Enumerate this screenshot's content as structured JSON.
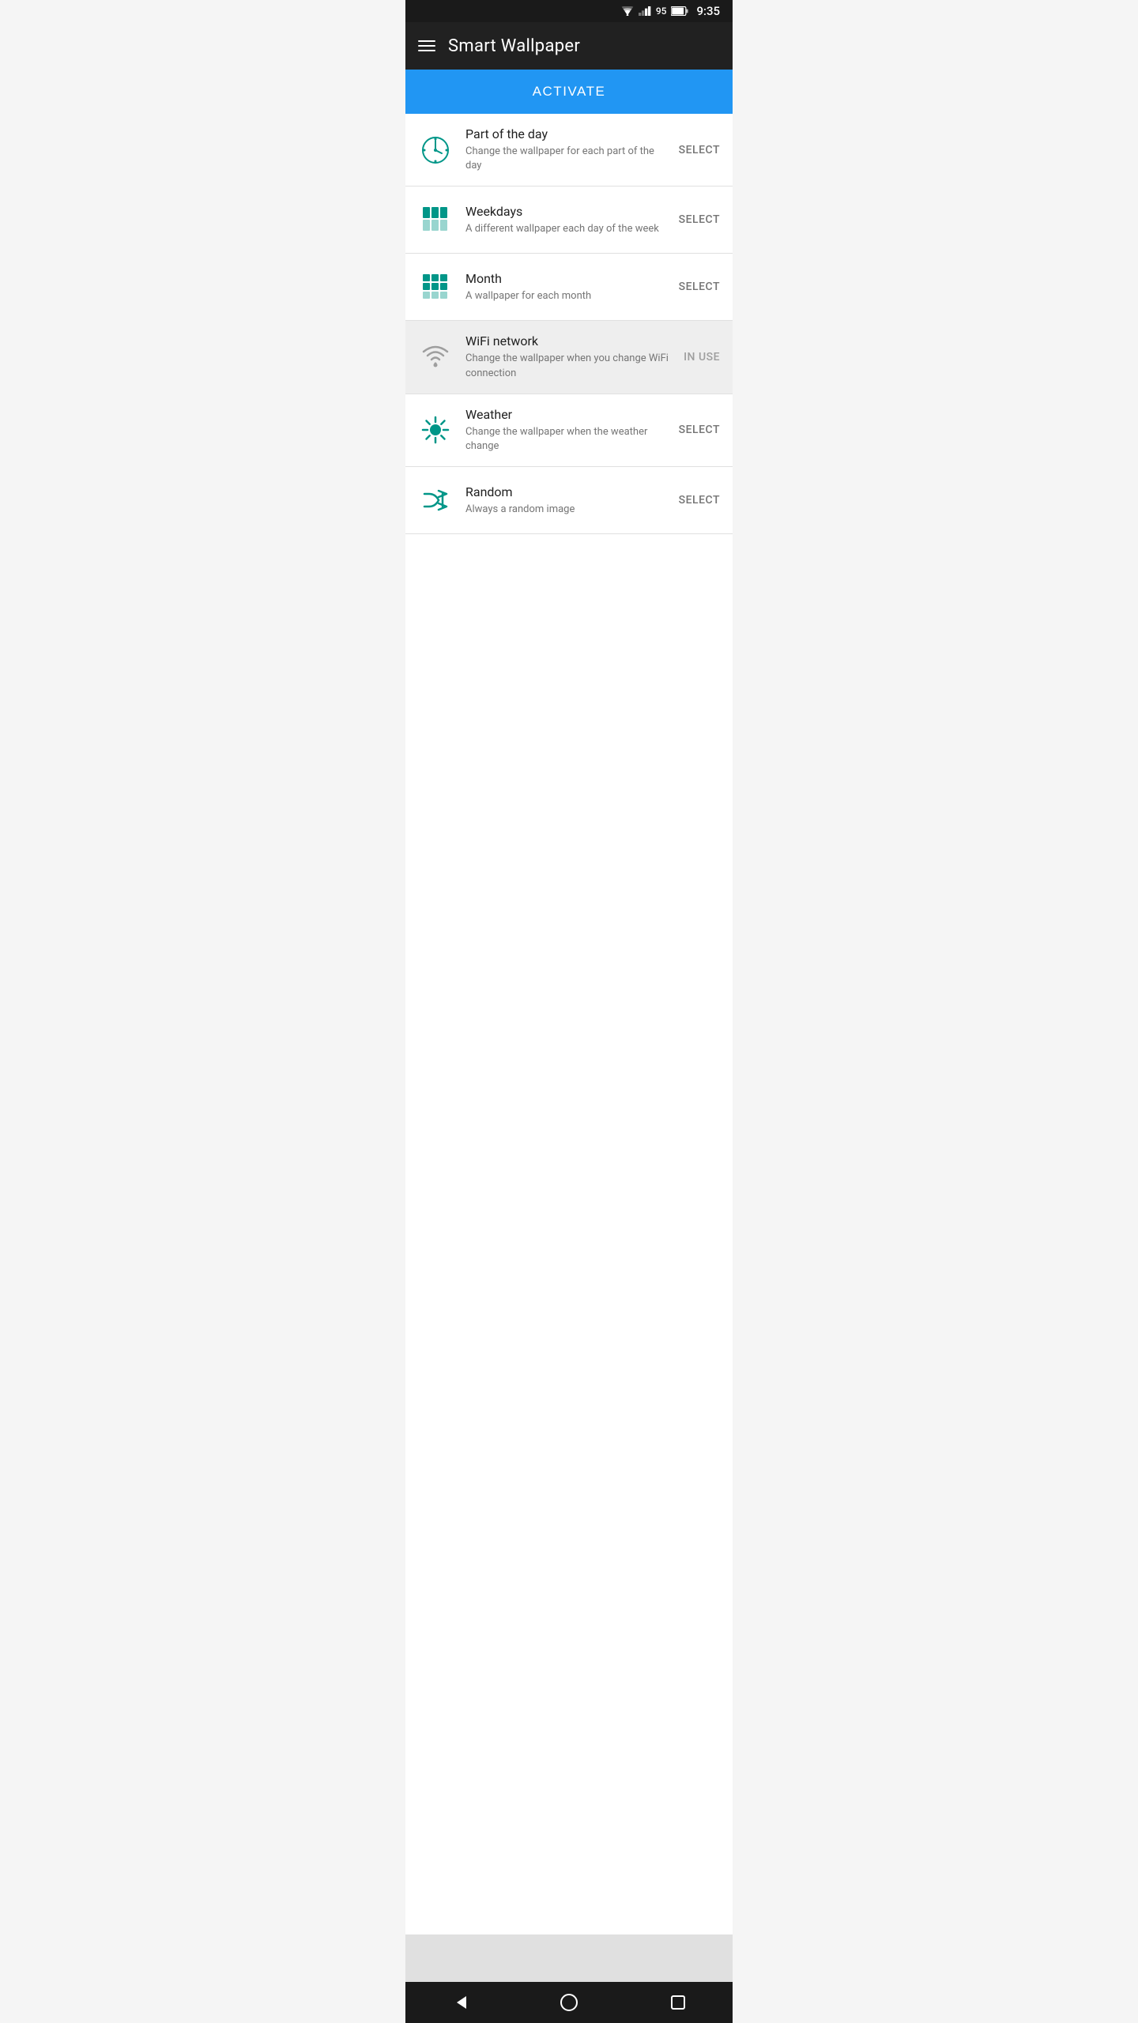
{
  "statusBar": {
    "time": "9:35",
    "batteryLevel": "95"
  },
  "appBar": {
    "title": "Smart Wallpaper",
    "menuIcon": "menu-icon"
  },
  "activateButton": {
    "label": "ACTIVATE"
  },
  "listItems": [
    {
      "id": "part-of-day",
      "title": "Part of the day",
      "subtitle": "Change the wallpaper for each part of the day",
      "action": "SELECT",
      "highlighted": false,
      "iconType": "clock"
    },
    {
      "id": "weekdays",
      "title": "Weekdays",
      "subtitle": "A different wallpaper each day of the week",
      "action": "SELECT",
      "highlighted": false,
      "iconType": "grid3"
    },
    {
      "id": "month",
      "title": "Month",
      "subtitle": "A wallpaper for each month",
      "action": "SELECT",
      "highlighted": false,
      "iconType": "grid4"
    },
    {
      "id": "wifi-network",
      "title": "WiFi network",
      "subtitle": "Change the wallpaper when you change WiFi connection",
      "action": "IN USE",
      "highlighted": true,
      "iconType": "wifi"
    },
    {
      "id": "weather",
      "title": "Weather",
      "subtitle": "Change the wallpaper when the weather change",
      "action": "SELECT",
      "highlighted": false,
      "iconType": "sun"
    },
    {
      "id": "random",
      "title": "Random",
      "subtitle": "Always a random image",
      "action": "SELECT",
      "highlighted": false,
      "iconType": "shuffle"
    }
  ],
  "colors": {
    "teal": "#009688",
    "blue": "#2196f3",
    "darkBg": "#212121",
    "highlightBg": "#eeeeee"
  }
}
